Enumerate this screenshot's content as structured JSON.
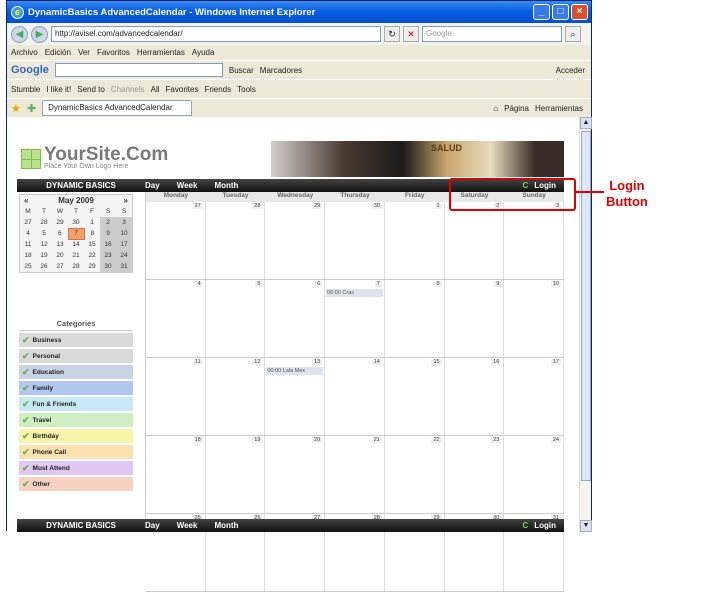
{
  "window": {
    "title": "DynamicBasics AdvancedCalendar - Windows Internet Explorer"
  },
  "address": {
    "url": "http://avisel.com/advancedcalendar/",
    "search_placeholder": "Google"
  },
  "menu": [
    "Archivo",
    "Edición",
    "Ver",
    "Favoritos",
    "Herramientas",
    "Ayuda"
  ],
  "google_bar": {
    "logo": "Google",
    "buscar": "Buscar",
    "marcadores": "Marcadores",
    "acceder": "Acceder"
  },
  "links_bar": [
    "Stumble",
    "I like it!",
    "Send to",
    "Channels",
    "All",
    "Favorites",
    "Friends",
    "Tools"
  ],
  "tab": {
    "label": "DynamicBasics AdvancedCalendar",
    "pagina": "Página",
    "herramientas": "Herramientas"
  },
  "site": {
    "logo_title": "YourSite.Com",
    "logo_sub": "Place Your Own Logo Here",
    "banner_text": "SALUD"
  },
  "nav": {
    "brand": "DYNAMIC BASICS",
    "items": [
      "Day",
      "Week",
      "Month"
    ],
    "login": "Login"
  },
  "mini": {
    "prev": "«",
    "title": "May 2009",
    "next": "»",
    "weekdays": [
      "M",
      "T",
      "W",
      "T",
      "F",
      "S",
      "S"
    ],
    "rows": [
      [
        "27",
        "28",
        "29",
        "30",
        "1",
        "2",
        "3"
      ],
      [
        "4",
        "5",
        "6",
        "7",
        "8",
        "9",
        "10"
      ],
      [
        "11",
        "12",
        "13",
        "14",
        "15",
        "16",
        "17"
      ],
      [
        "18",
        "19",
        "20",
        "21",
        "22",
        "23",
        "24"
      ],
      [
        "25",
        "26",
        "27",
        "28",
        "29",
        "30",
        "31"
      ]
    ]
  },
  "categories": {
    "title": "Categories",
    "items": [
      {
        "label": "Business",
        "color": "#d9d9d9"
      },
      {
        "label": "Personal",
        "color": "#d9d9d9"
      },
      {
        "label": "Education",
        "color": "#c9d3e6"
      },
      {
        "label": "Family",
        "color": "#b3c6f0"
      },
      {
        "label": "Fun & Friends",
        "color": "#c6e9f4"
      },
      {
        "label": "Travel",
        "color": "#cfeec2"
      },
      {
        "label": "Birthday",
        "color": "#f9f5a8"
      },
      {
        "label": "Phone Call",
        "color": "#fbe1b0"
      },
      {
        "label": "Must Attend",
        "color": "#e0c8f2"
      },
      {
        "label": "Other",
        "color": "#f9d1c2"
      }
    ]
  },
  "calendar": {
    "days": [
      "Monday",
      "Tuesday",
      "Wednesday",
      "Thursday",
      "Friday",
      "Saturday",
      "Sunday"
    ],
    "weeks": [
      [
        "27",
        "28",
        "29",
        "30",
        "1",
        "2",
        "3"
      ],
      [
        "4",
        "5",
        "6",
        "7",
        "8",
        "9",
        "10"
      ],
      [
        "11",
        "12",
        "13",
        "14",
        "15",
        "16",
        "17"
      ],
      [
        "18",
        "19",
        "20",
        "21",
        "22",
        "23",
        "24"
      ],
      [
        "25",
        "26",
        "27",
        "28",
        "29",
        "30",
        "31"
      ]
    ],
    "events": [
      {
        "week": 1,
        "day": 3,
        "text": "00:00 Cras"
      },
      {
        "week": 2,
        "day": 2,
        "text": "00:00 Lala Mex"
      }
    ]
  },
  "annotation": {
    "line1": "Login",
    "line2": "Button"
  }
}
